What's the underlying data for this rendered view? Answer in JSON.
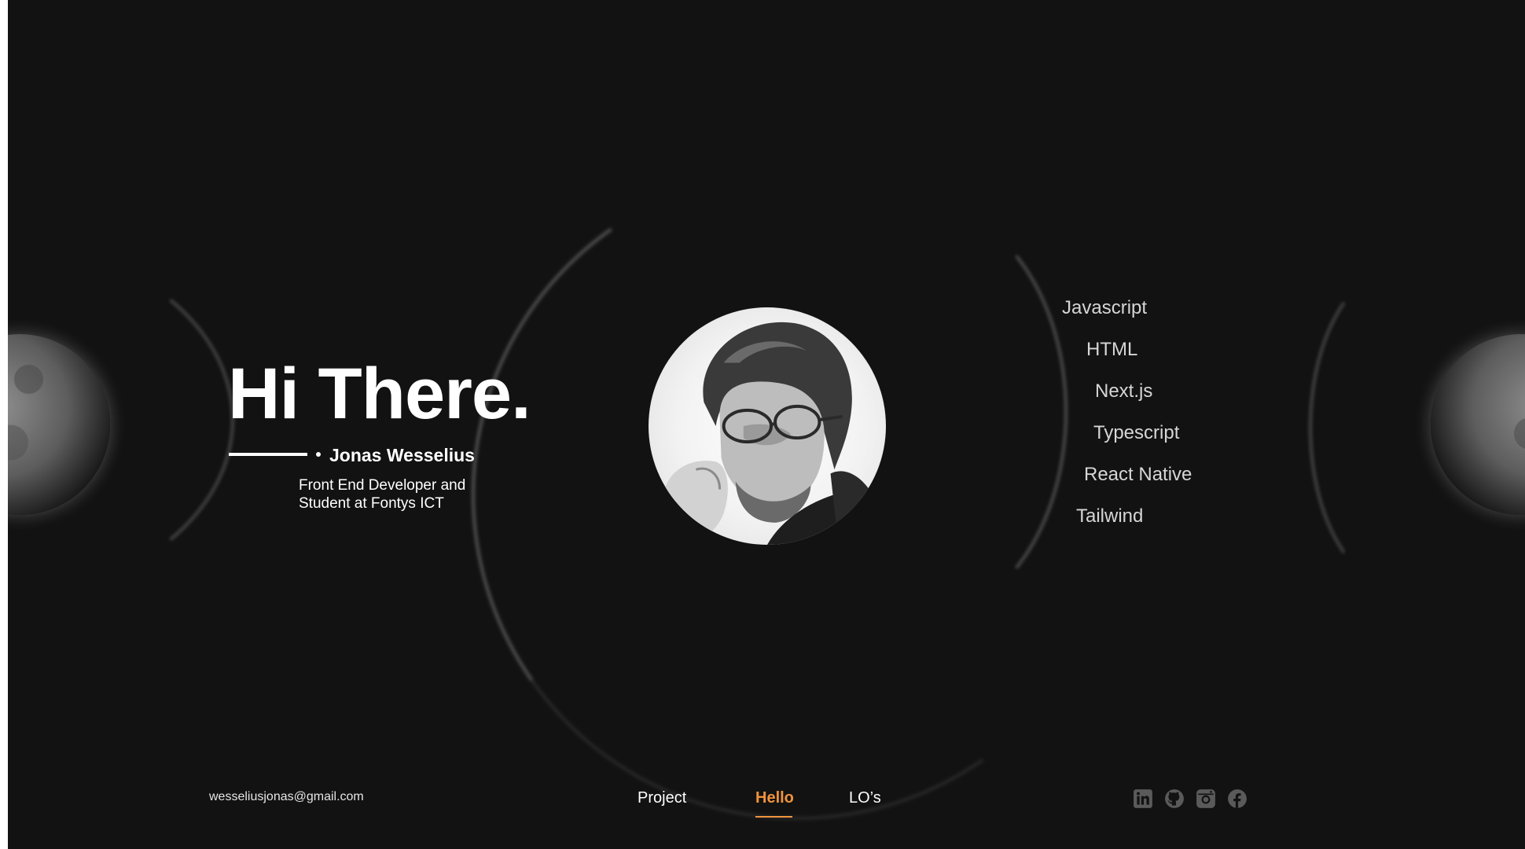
{
  "hero": {
    "title": "Hi There.",
    "name": "Jonas Wesselius",
    "role_line1": "Front End Developer and",
    "role_line2": "Student at Fontys ICT"
  },
  "avatar": {
    "icon": "portrait-photo"
  },
  "skills": [
    "Javascript",
    "HTML",
    "Next.js",
    "Typescript",
    "React Native",
    "Tailwind"
  ],
  "footer": {
    "email": "wesseliusjonas@gmail.com",
    "nav": [
      {
        "label": "Project",
        "active": false
      },
      {
        "label": "Hello",
        "active": true
      },
      {
        "label": "LO’s",
        "active": false
      }
    ],
    "socials": [
      "linkedin-icon",
      "github-icon",
      "instagram-icon",
      "facebook-icon"
    ]
  },
  "colors": {
    "background": "#121212",
    "accent": "#f0933d",
    "text": "#ffffff",
    "muted_text": "#d6d6d6",
    "icon": "#5a5a5a"
  }
}
